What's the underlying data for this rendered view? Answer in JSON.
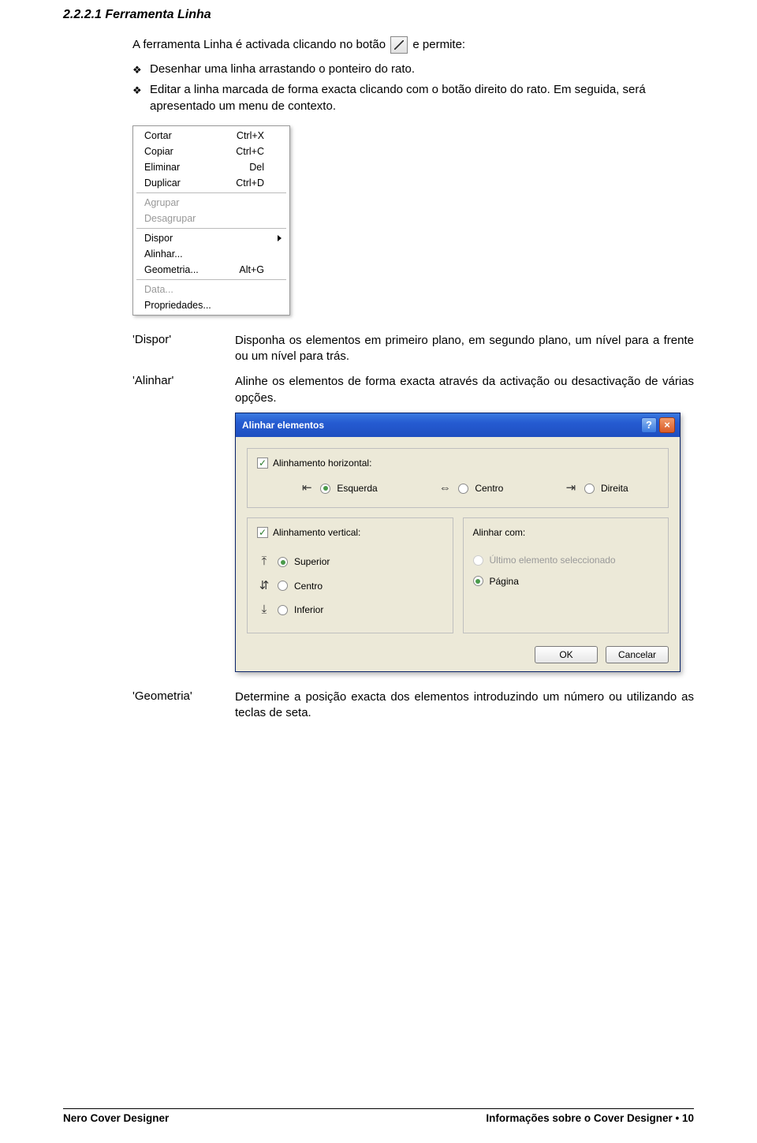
{
  "heading": "2.2.2.1  Ferramenta Linha",
  "intro_prefix": "A ferramenta Linha é activada clicando no botão ",
  "intro_suffix": " e permite:",
  "bullets": [
    "Desenhar uma linha arrastando o ponteiro do rato.",
    "Editar a linha marcada de forma exacta clicando com o botão direito do rato. Em seguida, será apresentado um menu de contexto."
  ],
  "context_menu": {
    "items": [
      {
        "label": "Cortar",
        "short": "Ctrl+X",
        "disabled": false
      },
      {
        "label": "Copiar",
        "short": "Ctrl+C",
        "disabled": false
      },
      {
        "label": "Eliminar",
        "short": "Del",
        "disabled": false
      },
      {
        "label": "Duplicar",
        "short": "Ctrl+D",
        "disabled": false
      }
    ],
    "group2": [
      {
        "label": "Agrupar",
        "disabled": true
      },
      {
        "label": "Desagrupar",
        "disabled": true
      }
    ],
    "group3": [
      {
        "label": "Dispor",
        "submenu": true
      },
      {
        "label": "Alinhar..."
      },
      {
        "label": "Geometria...",
        "short": "Alt+G"
      }
    ],
    "group4": [
      {
        "label": "Data...",
        "disabled": true
      },
      {
        "label": "Propriedades..."
      }
    ]
  },
  "definitions": [
    {
      "term": "'Dispor'",
      "body": "Disponha os elementos em primeiro plano, em segundo plano, um nível para a frente ou um nível para trás."
    },
    {
      "term": "'Alinhar'",
      "body": "Alinhe os elementos de forma exacta através da activação ou desactivação de várias opções."
    }
  ],
  "dialog": {
    "title": "Alinhar elementos",
    "horiz_label": "Alinhamento horizontal:",
    "horiz_opts": [
      {
        "icon": "⇤",
        "label": "Esquerda",
        "selected": true
      },
      {
        "icon": "⇔",
        "label": "Centro",
        "selected": false
      },
      {
        "icon": "⇥",
        "label": "Direita",
        "selected": false
      }
    ],
    "vert_label": "Alinhamento vertical:",
    "vert_opts": [
      {
        "icon": "⤒",
        "label": "Superior",
        "selected": true
      },
      {
        "icon": "⇵",
        "label": "Centro",
        "selected": false
      },
      {
        "icon": "⤓",
        "label": "Inferior",
        "selected": false
      }
    ],
    "alinhar_com": "Alinhar com:",
    "alinhar_opts": [
      {
        "label": "Último elemento seleccionado",
        "selected": false,
        "disabled": true
      },
      {
        "label": "Página",
        "selected": true,
        "disabled": false
      }
    ],
    "ok": "OK",
    "cancel": "Cancelar"
  },
  "geometria": {
    "term": "'Geometria'",
    "body": "Determine a posição exacta dos elementos introduzindo um número ou utilizando as teclas de seta."
  },
  "footer": {
    "left": "Nero Cover Designer",
    "right_prefix": "Informações sobre o Cover Designer",
    "page": "10"
  }
}
